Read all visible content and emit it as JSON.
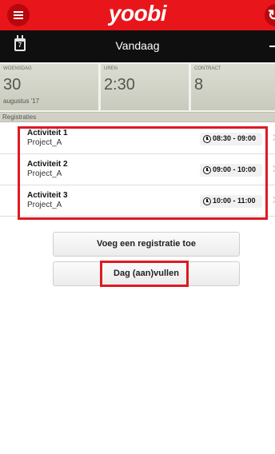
{
  "header": {
    "brand": "yoobi",
    "icons": {
      "menu": "menu-icon",
      "refresh": "refresh-icon"
    },
    "colors": {
      "brand_red": "#e8151b",
      "date_bar": "#0f0f0f",
      "highlight": "#dd1a22"
    }
  },
  "datebar": {
    "calendar_day": "7",
    "title": "Vandaag"
  },
  "summary": {
    "tiles": [
      {
        "label": "WOENSDAG",
        "value": "30",
        "sub": "augustus '17"
      },
      {
        "label": "UREN",
        "value": "2:30"
      },
      {
        "label": "CONTRACT",
        "value": "8"
      }
    ]
  },
  "section": {
    "label": "Registraties"
  },
  "activities": [
    {
      "title": "Activiteit 1",
      "project": "Project_A",
      "time": "08:30 - 09:00"
    },
    {
      "title": "Activiteit 2",
      "project": "Project_A",
      "time": "09:00 - 10:00"
    },
    {
      "title": "Activiteit 3",
      "project": "Project_A",
      "time": "10:00 - 11:00"
    }
  ],
  "buttons": {
    "add": "Voeg een registratie toe",
    "fill": "Dag (aan)vullen"
  }
}
